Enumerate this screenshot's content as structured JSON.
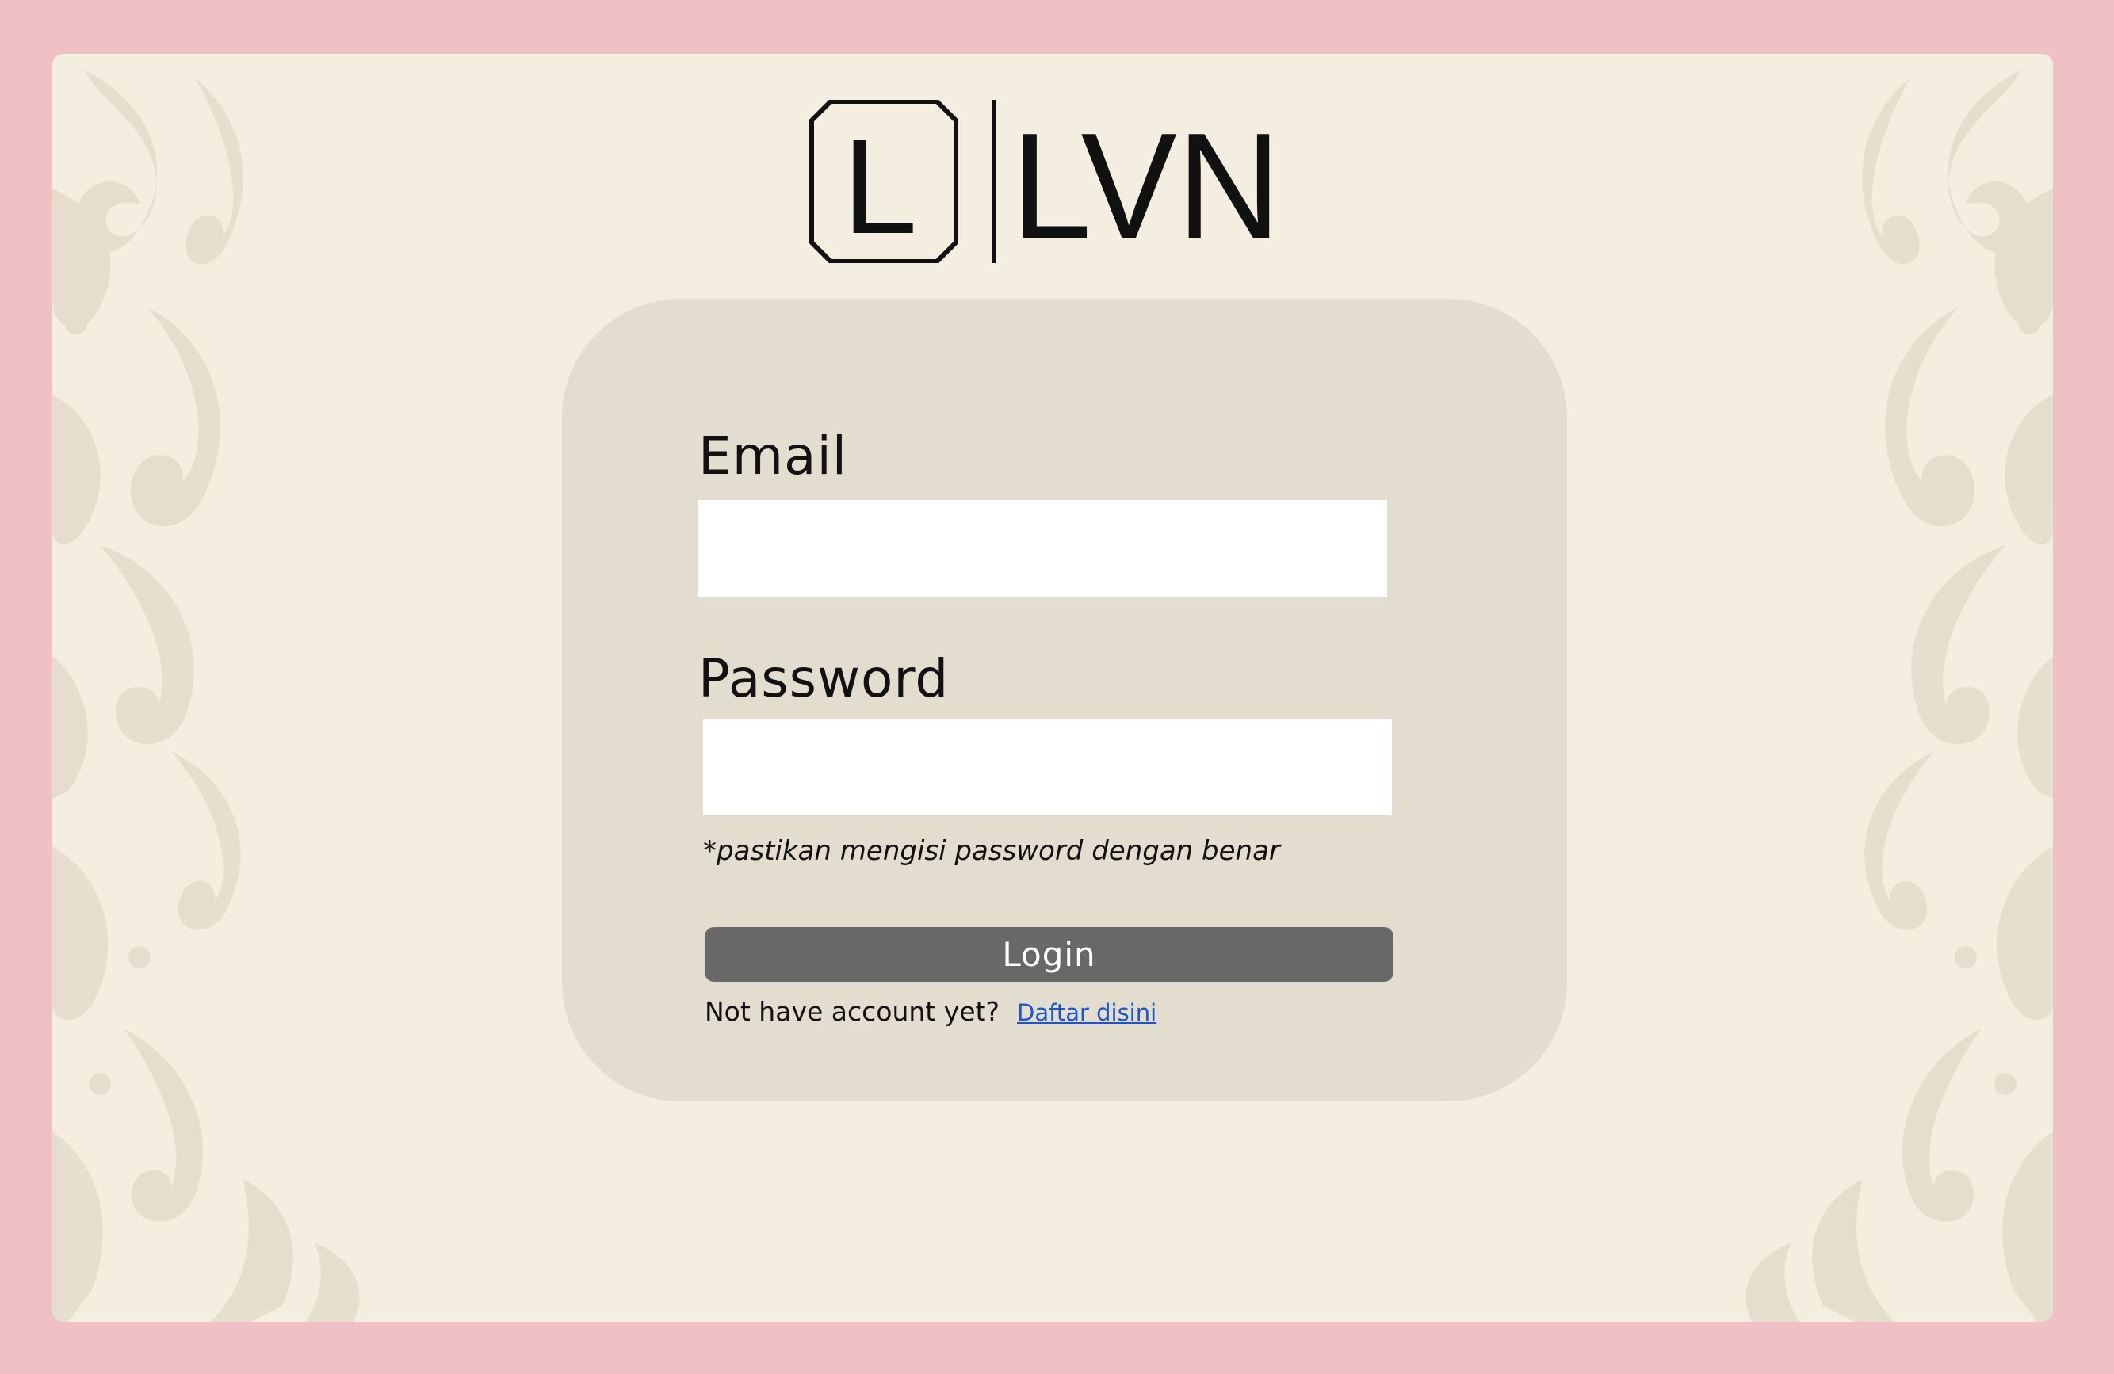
{
  "brand": {
    "logo_mark": "L",
    "logo_text": "LVN"
  },
  "form": {
    "email_label": "Email",
    "email_value": "",
    "email_placeholder": "",
    "password_label": "Password",
    "password_value": "",
    "password_placeholder": "",
    "password_hint": "*pastikan mengisi password dengan benar",
    "login_label": "Login",
    "signup_prompt": "Not have account yet?",
    "signup_link": "Daftar disini"
  },
  "colors": {
    "outer_background": "#efc1c4",
    "page_background": "#f4eee0",
    "card_background": "#e2ddcf",
    "button_background": "#686868",
    "link": "#1a56c9"
  }
}
